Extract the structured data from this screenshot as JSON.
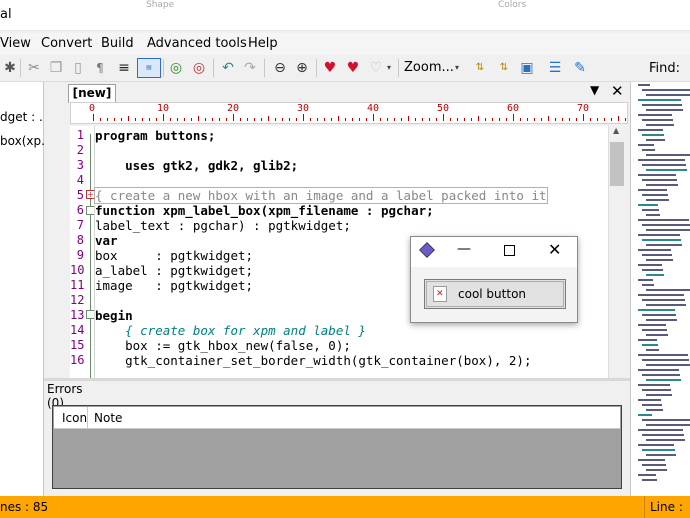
{
  "window": {
    "title_partial": "al",
    "ghost_labels": [
      "Shape",
      "Colors"
    ]
  },
  "menu": {
    "items": [
      "View",
      "Convert",
      "Build",
      "Advanced tools",
      "Help"
    ]
  },
  "toolbar": {
    "zoom_label": "Zoom...",
    "find_label": "Find:"
  },
  "sidebar": {
    "items": [
      "dget : ...",
      "box(xp..."
    ]
  },
  "editor": {
    "tab_label": "[new]",
    "ruler_marks": [
      "0",
      "10",
      "20",
      "30",
      "40",
      "50",
      "60",
      "70"
    ],
    "lines": [
      {
        "n": "1",
        "text": "program buttons;"
      },
      {
        "n": "2",
        "text": ""
      },
      {
        "n": "3",
        "text": "    uses gtk2, gdk2, glib2;"
      },
      {
        "n": "4",
        "text": ""
      },
      {
        "n": "5",
        "text": "{ create a new hbox with an image and a label packed into it"
      },
      {
        "n": "6",
        "text": "function xpm_label_box(xpm_filename : pgchar;"
      },
      {
        "n": "7",
        "text": "label_text : pgchar) : pgtkwidget;"
      },
      {
        "n": "8",
        "text": "var"
      },
      {
        "n": "9",
        "text": "box     : pgtkwidget;"
      },
      {
        "n": "10",
        "text": "a_label : pgtkwidget;"
      },
      {
        "n": "11",
        "text": "image   : pgtkwidget;"
      },
      {
        "n": "12",
        "text": ""
      },
      {
        "n": "13",
        "text": "begin"
      },
      {
        "n": "14",
        "text": "    { create box for xpm and label }"
      },
      {
        "n": "15",
        "text": "    box := gtk_hbox_new(false, 0);"
      },
      {
        "n": "16",
        "text": "    gtk_container_set_border_width(gtk_container(box), 2);"
      }
    ]
  },
  "errors": {
    "tab_label": "Errors (0)",
    "columns": [
      "Icon",
      "Note"
    ]
  },
  "status": {
    "left": "nes : 85",
    "right": "Line :"
  },
  "popup": {
    "button_label": "cool button"
  },
  "colors": {
    "status_bar": "#ffa500",
    "line_numbers": "#7d007d",
    "ruler": "#c00000",
    "keyword": "#000080",
    "comment": "#008080"
  }
}
